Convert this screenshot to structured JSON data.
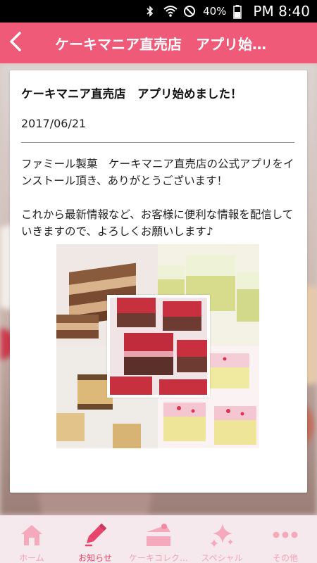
{
  "status_bar": {
    "battery": "40%",
    "time": "PM 8:40",
    "icons": [
      "bluetooth-icon",
      "wifi-icon",
      "do-not-disturb-icon",
      "battery-icon"
    ]
  },
  "header": {
    "title": "ケーキマニア直売店　アプリ始…",
    "back_icon": "chevron-left-icon",
    "color": "#ee5a78"
  },
  "post": {
    "title": "ケーキマニア直売店　アプリ始めました！",
    "date": "2017/06/21",
    "body": "ファミール製菓　ケーキマニア直売店の公式アプリをインストール頂き、ありがとうございます！\n\nこれから最新情報など、お客様に便利な情報を配信していきますので、よろしくお願いします♪"
  },
  "tabs": [
    {
      "label": "ホーム",
      "icon": "home-icon",
      "active": false
    },
    {
      "label": "お知らせ",
      "icon": "pencil-icon",
      "active": true
    },
    {
      "label": "ケーキコレク…",
      "icon": "cake-icon",
      "active": false
    },
    {
      "label": "スペシャル",
      "icon": "sparkle-icon",
      "active": false
    },
    {
      "label": "その他",
      "icon": "more-icon",
      "active": false
    }
  ],
  "colors": {
    "accent": "#ee5a78",
    "tab_active": "#e8456d",
    "tab_inactive": "#f2a3b7"
  }
}
